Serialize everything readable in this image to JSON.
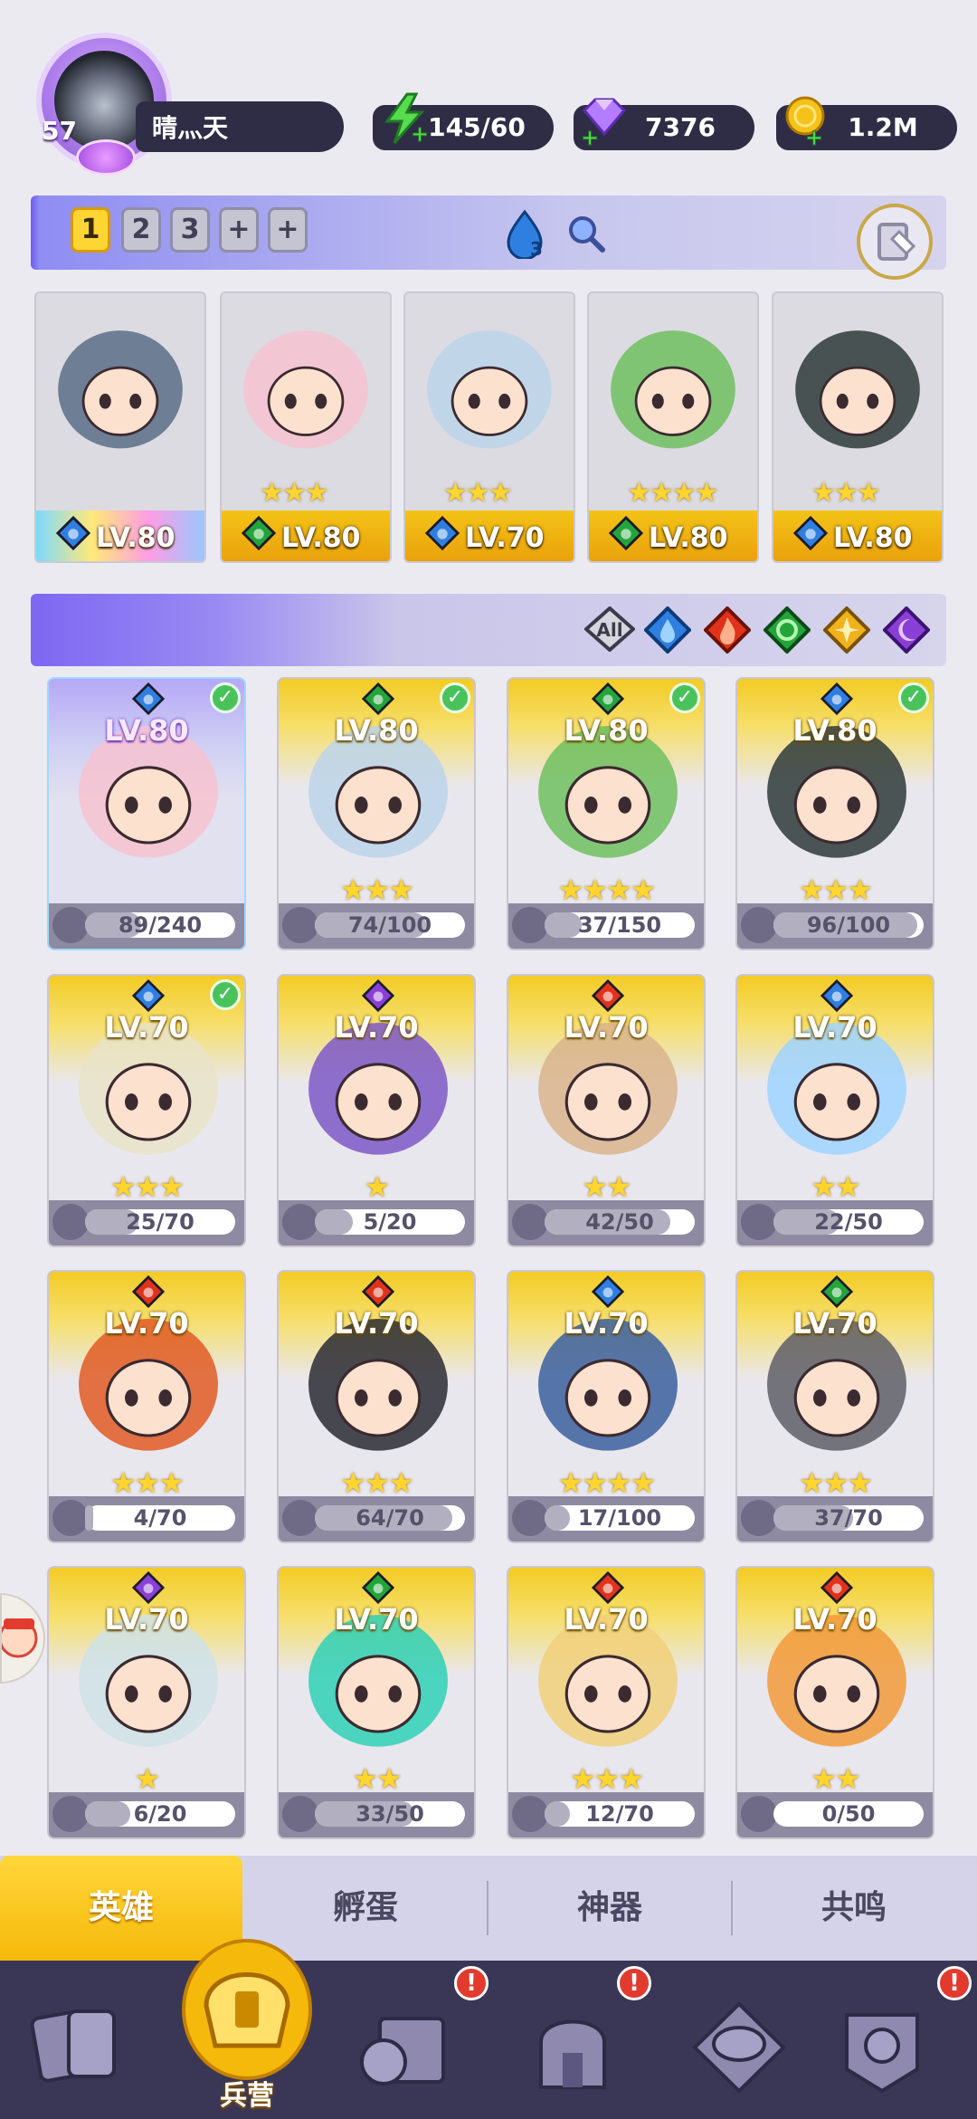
{
  "player": {
    "level": "57",
    "name": "晴灬天"
  },
  "resources": {
    "energy": "145/60",
    "gems": "7376",
    "gold": "1.2M"
  },
  "team": {
    "tabs": [
      "1",
      "2",
      "3",
      "+",
      "+"
    ],
    "active_tab": "1",
    "element_count": "3"
  },
  "team_heroes": [
    {
      "level": "LV.80",
      "element": "water",
      "stars": ""
    },
    {
      "level": "LV.80",
      "element": "wind",
      "stars": "★★★"
    },
    {
      "level": "LV.70",
      "element": "water",
      "stars": "★★★"
    },
    {
      "level": "LV.80",
      "element": "wind",
      "stars": "★★★★"
    },
    {
      "level": "LV.80",
      "element": "water",
      "stars": "★★★"
    }
  ],
  "filter": {
    "all_label": "All"
  },
  "heroes": [
    {
      "level": "LV.80",
      "element": "water",
      "stars": "",
      "progress": "89/240",
      "checked": true,
      "purple": true
    },
    {
      "level": "LV.80",
      "element": "wind",
      "stars": "★★★",
      "progress": "74/100",
      "checked": true
    },
    {
      "level": "LV.80",
      "element": "wind",
      "stars": "★★★★",
      "progress": "37/150",
      "checked": true
    },
    {
      "level": "LV.80",
      "element": "water",
      "stars": "★★★",
      "progress": "96/100",
      "checked": true
    },
    {
      "level": "LV.70",
      "element": "water",
      "stars": "★★★",
      "progress": "25/70",
      "checked": true
    },
    {
      "level": "LV.70",
      "element": "dark",
      "stars": "★",
      "progress": "5/20",
      "checked": false
    },
    {
      "level": "LV.70",
      "element": "fire",
      "stars": "★★",
      "progress": "42/50",
      "checked": false
    },
    {
      "level": "LV.70",
      "element": "water",
      "stars": "★★",
      "progress": "22/50",
      "checked": false
    },
    {
      "level": "LV.70",
      "element": "fire",
      "stars": "★★★",
      "progress": "4/70",
      "checked": false
    },
    {
      "level": "LV.70",
      "element": "fire",
      "stars": "★★★",
      "progress": "64/70",
      "checked": false
    },
    {
      "level": "LV.70",
      "element": "water",
      "stars": "★★★★",
      "progress": "17/100",
      "checked": false
    },
    {
      "level": "LV.70",
      "element": "wind",
      "stars": "★★★",
      "progress": "37/70",
      "checked": false
    },
    {
      "level": "LV.70",
      "element": "dark",
      "stars": "★",
      "progress": "6/20",
      "checked": false
    },
    {
      "level": "LV.70",
      "element": "wind",
      "stars": "★★",
      "progress": "33/50",
      "checked": false
    },
    {
      "level": "LV.70",
      "element": "fire",
      "stars": "★★★",
      "progress": "12/70",
      "checked": false
    },
    {
      "level": "LV.70",
      "element": "fire",
      "stars": "★★",
      "progress": "0/50",
      "checked": false
    }
  ],
  "subtabs": [
    "英雄",
    "孵蛋",
    "神器",
    "共鸣"
  ],
  "nav": {
    "barracks_label": "兵营",
    "badge": "!"
  },
  "colors": {
    "water": "#2f7fe0",
    "wind": "#23a53b",
    "fire": "#e0331b",
    "light": "#f0b21d",
    "dark": "#8a3fd6",
    "gold": "#f5c21a"
  }
}
